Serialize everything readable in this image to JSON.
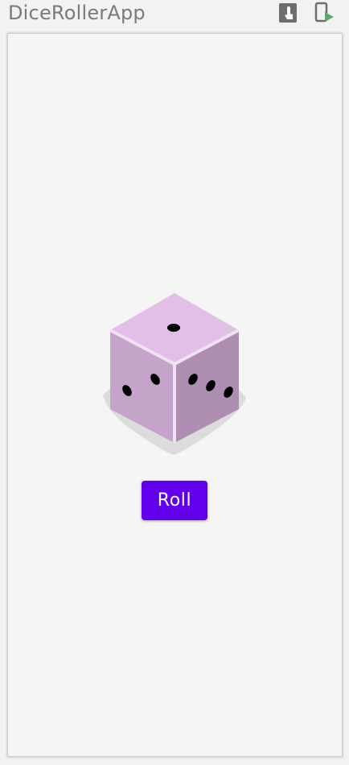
{
  "app": {
    "title": "DiceRollerApp"
  },
  "toolbar_icons": {
    "touch": "touch-interaction-icon",
    "device": "device-run-icon"
  },
  "main": {
    "dice_value": 3,
    "roll_button_label": "Roll"
  },
  "colors": {
    "accent": "#6200ee",
    "dice_top": "#e1bee7",
    "dice_side": "#c5a3cc",
    "background": "#f5f5f5"
  }
}
